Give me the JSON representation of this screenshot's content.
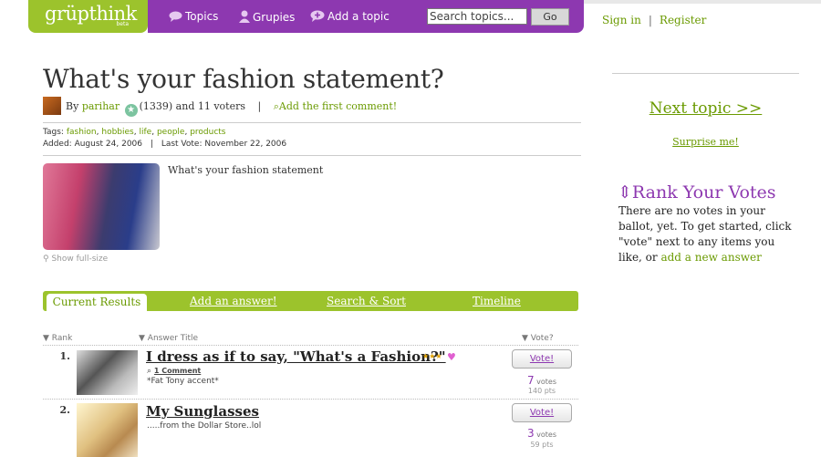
{
  "brand": {
    "name": "grüpthink",
    "tag": "beta"
  },
  "nav": {
    "topics": "Topics",
    "grupies": "Grupies",
    "add_topic": "Add a topic",
    "search_placeholder": "Search topics...",
    "go": "Go"
  },
  "auth": {
    "sign_in": "Sign in",
    "separator": "|",
    "register": "Register"
  },
  "topic": {
    "title": "What's your fashion statement?",
    "by": "By",
    "author": "parihar",
    "author_score": "(1339)",
    "voters": "and 11 voters",
    "separator": "|",
    "add_comment": "Add the first comment!",
    "tags_label": "Tags:",
    "tags": [
      "fashion",
      "hobbies",
      "life",
      "people",
      "products"
    ],
    "added": "Added: August 24, 2006",
    "last_vote": "Last Vote: November 22, 2006",
    "description": "What's your fashion statement",
    "show_full": "Show full-size"
  },
  "tabs": {
    "current": "Current Results",
    "add_answer": "Add an answer!",
    "search_sort": "Search & Sort",
    "timeline": "Timeline"
  },
  "columns": {
    "rank": "Rank",
    "answer": "Answer Title",
    "vote": "Vote?"
  },
  "answers": [
    {
      "rank": "1.",
      "title": "I dress as if to say, \"What's a Fashion?\"",
      "comments": "1 Comment",
      "subtitle": "*Fat Tony accent*",
      "vote_label": "Vote!",
      "votes": "7",
      "votes_label": "votes",
      "points": "140 pts"
    },
    {
      "rank": "2.",
      "title": "My Sunglasses",
      "subtitle": ".....from the Dollar Store..lol",
      "vote_label": "Vote!",
      "votes": "3",
      "votes_label": "votes",
      "points": "59 pts"
    }
  ],
  "sidebar": {
    "next_topic": "Next topic >>",
    "surprise": "Surprise me!",
    "rank_title": "Rank Your Votes",
    "rank_text": "There are no votes in your ballot, yet. To get started, click \"vote\" next to any items you like, or",
    "rank_link": "add a new answer"
  },
  "colors": {
    "green": "#9cc32c",
    "purple": "#8d38b0",
    "link": "#6a9a00"
  }
}
